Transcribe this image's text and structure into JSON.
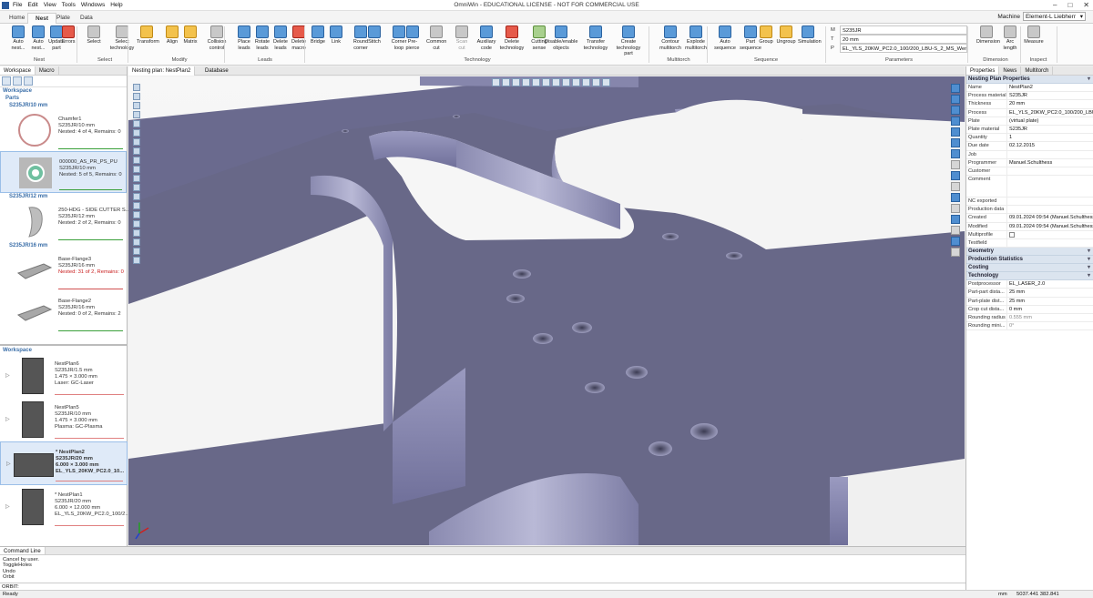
{
  "app": {
    "title": "OmniWin - EDUCATIONAL LICENSE - NOT FOR COMMERCIAL USE",
    "menu": [
      "File",
      "Edit",
      "View",
      "Tools",
      "Windows",
      "Help"
    ],
    "window_controls": [
      "–",
      "□",
      "✕"
    ]
  },
  "ribbon_tabs": [
    "Home",
    "Nest",
    "Plate",
    "Data"
  ],
  "machine": {
    "label": "Machine",
    "value": "Element-L Liebherr"
  },
  "ribbon": {
    "buttons": [
      {
        "label": "Auto\nnest...",
        "icon": "auto-nest-icon"
      },
      {
        "label": "Auto\nnest...",
        "icon": "auto-nest-settings-icon"
      },
      {
        "label": "Update\npart",
        "icon": "update-part-icon"
      },
      {
        "label": "Errors",
        "icon": "errors-icon"
      },
      {
        "label": "Select",
        "icon": "select-icon"
      },
      {
        "label": "Select\ntechnology",
        "icon": "select-technology-icon"
      },
      {
        "label": "Transform",
        "icon": "transform-icon"
      },
      {
        "label": "Align",
        "icon": "align-icon"
      },
      {
        "label": "Matrix",
        "icon": "matrix-icon"
      },
      {
        "label": "Collision\ncontrol",
        "icon": "collision-control-icon"
      },
      {
        "label": "Place\nleads",
        "icon": "place-leads-icon"
      },
      {
        "label": "Rotate\nleads",
        "icon": "rotate-leads-icon"
      },
      {
        "label": "Delete\nleads",
        "icon": "delete-leads-icon"
      },
      {
        "label": "Delete\nmacro",
        "icon": "delete-macro-icon"
      },
      {
        "label": "Bridge",
        "icon": "bridge-icon"
      },
      {
        "label": "Link",
        "icon": "link-icon"
      },
      {
        "label": "Round\ncorner",
        "icon": "round-corner-icon"
      },
      {
        "label": "Stitch",
        "icon": "stitch-icon"
      },
      {
        "label": "Corner\nloop",
        "icon": "corner-loop-icon"
      },
      {
        "label": "Pre-pierce",
        "icon": "pre-pierce-icon"
      },
      {
        "label": "Common\ncut",
        "icon": "common-cut-icon"
      },
      {
        "label": "Scan\ncut",
        "icon": "scan-cut-icon"
      },
      {
        "label": "Auxiliary\ncode",
        "icon": "auxiliary-code-icon"
      },
      {
        "label": "Delete\ntechnology",
        "icon": "delete-technology-icon"
      },
      {
        "label": "Cutting\nsense",
        "icon": "cutting-sense-icon"
      },
      {
        "label": "Disable/enable\nobjects",
        "icon": "disable-enable-icon"
      },
      {
        "label": "Transfer\ntechnology",
        "icon": "transfer-technology-icon"
      },
      {
        "label": "Create\ntechnology part",
        "icon": "create-technology-part-icon"
      },
      {
        "label": "Contour\nmultitorch",
        "icon": "contour-multitorch-icon"
      },
      {
        "label": "Explode\nmultitorch",
        "icon": "explode-multitorch-icon"
      },
      {
        "label": "Auto\nsequence",
        "icon": "auto-sequence-icon"
      },
      {
        "label": "Part\nsequence",
        "icon": "part-sequence-icon"
      },
      {
        "label": "Group",
        "icon": "group-icon"
      },
      {
        "label": "Ungroup",
        "icon": "ungroup-icon"
      },
      {
        "label": "Simulation",
        "icon": "simulation-icon"
      },
      {
        "label": "Dimension",
        "icon": "dimension-icon"
      },
      {
        "label": "Arc\nlength",
        "icon": "arc-length-icon"
      },
      {
        "label": "Measure",
        "icon": "measure-icon"
      }
    ],
    "groups": [
      "Nest",
      "Select",
      "Modify",
      "Leads",
      "Technology",
      "Multitorch",
      "Sequence",
      "Parameters",
      "Dimension",
      "Inspect"
    ],
    "parameters": {
      "m": "S235JR",
      "t": "20 mm",
      "p": "EL_YLS_20KW_PC2.0_100/200_LBU-S_2_MS_Werte Fabian"
    }
  },
  "left_panel": {
    "tabs": [
      "Workspace",
      "Macro"
    ],
    "workspace_label": "Workspace",
    "parts_label": "Parts",
    "groups": [
      {
        "name": "S235JR/10 mm",
        "parts": [
          {
            "name": "Chamfer1",
            "mat": "S235JR/10 mm",
            "nested": "Nested: 4 of 4, Remains: 0",
            "warn": false
          },
          {
            "name": "000000_AS_PR_PS_PU",
            "mat": "S235JR/10 mm",
            "nested": "Nested: 5 of 5, Remains: 0",
            "warn": false
          }
        ]
      },
      {
        "name": "S235JR/12 mm",
        "parts": [
          {
            "name": "250-HDG - SIDE CUTTER S...",
            "mat": "S235JR/12 mm",
            "nested": "Nested: 2 of 2, Remains: 0",
            "warn": false
          }
        ]
      },
      {
        "name": "S235JR/16 mm",
        "parts": [
          {
            "name": "Base-Flange3",
            "mat": "S235JR/16 mm",
            "nested": "Nested: 31 of 2, Remains: 0",
            "warn": true
          },
          {
            "name": "Base-Flange2",
            "mat": "S235JR/16 mm",
            "nested": "Nested: 0 of 2, Remains: 2",
            "warn": false
          }
        ]
      }
    ],
    "workspace2_label": "Workspace",
    "plans": [
      {
        "name": "NestPlan6",
        "mat": "S235JR/1.5 mm",
        "size": "1.475 × 3.000 mm",
        "tech": "Laser: GC-Laser"
      },
      {
        "name": "NestPlan5",
        "mat": "S235JR/10 mm",
        "size": "1.475 × 3.000 mm",
        "tech": "Plasma: GC-Plasma"
      },
      {
        "name": "* NestPlan2",
        "mat": "S235JR/20 mm",
        "size": "6.000 × 3.000 mm",
        "tech": "EL_YLS_20KW_PC2.0_10..."
      },
      {
        "name": "* NestPlan1",
        "mat": "S235JR/20 mm",
        "size": "6.000 × 12.000 mm",
        "tech": "EL_YLS_20KW_PC2.0_100/2..."
      }
    ]
  },
  "viewport": {
    "tabs": [
      "Nesting plan: NestPlan2",
      "Database"
    ]
  },
  "properties": {
    "tabs": [
      "Properties",
      "News",
      "Multitorch"
    ],
    "header": "Nesting Plan Properties",
    "rows": [
      {
        "k": "Name",
        "v": "NestPlan2"
      },
      {
        "k": "Process material",
        "v": "S235JR"
      },
      {
        "k": "Thickness",
        "v": "20 mm"
      },
      {
        "k": "Process",
        "v": "EL_YLS_20KW_PC2.0_100/200_LBU-S..."
      },
      {
        "k": "Plate",
        "v": "(virtual plate)"
      },
      {
        "k": "Plate material",
        "v": "S235JR"
      },
      {
        "k": "Quantity",
        "v": "1"
      },
      {
        "k": "Due date",
        "v": "02.12.2015"
      },
      {
        "k": "Job",
        "v": ""
      },
      {
        "k": "Programmer",
        "v": "Manuel.Schulthess"
      },
      {
        "k": "Customer",
        "v": ""
      },
      {
        "k": "Comment",
        "v": ""
      },
      {
        "k": "NC exported",
        "v": ""
      },
      {
        "k": "Production data",
        "v": ""
      },
      {
        "k": "Created",
        "v": "09.01.2024 09:54 (Manuel.Schulthess)"
      },
      {
        "k": "Modified",
        "v": "09.01.2024 09:54 (Manuel.Schulthess)"
      },
      {
        "k": "Multiprofile",
        "v": ""
      },
      {
        "k": "Testfield",
        "v": ""
      }
    ],
    "sections": [
      "Geometry",
      "Production Statistics",
      "Costing",
      "Technology"
    ],
    "tech_rows": [
      {
        "k": "Postprocessor",
        "v": "EL_LASER_2.0"
      },
      {
        "k": "Part-part dista...",
        "v": "25 mm"
      },
      {
        "k": "Part-plate dist...",
        "v": "25 mm"
      },
      {
        "k": "Crop cut dista...",
        "v": "0 mm"
      },
      {
        "k": "Rounding radius",
        "v": "0.555 mm"
      },
      {
        "k": "Rounding mini...",
        "v": "0°"
      }
    ]
  },
  "command": {
    "tab": "Command Line",
    "log": [
      "Cancel by user.",
      "ToggleHoles",
      "Undo",
      "Orbit"
    ],
    "prompt": "ORBIT:"
  },
  "status": {
    "left": "Ready",
    "unit": "mm",
    "coords": "5037.441   382.841"
  }
}
